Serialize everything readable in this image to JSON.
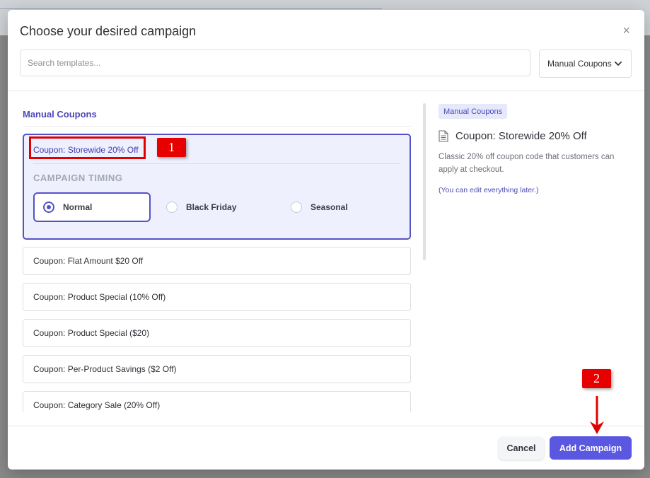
{
  "modal": {
    "title": "Choose your desired campaign",
    "close_icon": "×",
    "search": {
      "placeholder": "Search templates..."
    },
    "filter_select": {
      "value": "Manual Coupons"
    }
  },
  "list": {
    "section_title": "Manual Coupons",
    "selected_item": {
      "label": "Coupon: Storewide 20% Off",
      "timing_title": "CAMPAIGN TIMING",
      "timing_options": [
        {
          "label": "Normal",
          "selected": true
        },
        {
          "label": "Black Friday",
          "selected": false
        },
        {
          "label": "Seasonal",
          "selected": false
        }
      ]
    },
    "items": [
      "Coupon: Flat Amount $20 Off",
      "Coupon: Product Special (10% Off)",
      "Coupon: Product Special ($20)",
      "Coupon: Per-Product Savings ($2 Off)",
      "Coupon: Category Sale (20% Off)"
    ]
  },
  "preview": {
    "badge": "Manual Coupons",
    "title": "Coupon: Storewide 20% Off",
    "description": "Classic 20% off coupon code that customers can apply at checkout.",
    "note": "(You can edit everything later.)"
  },
  "footer": {
    "cancel_label": "Cancel",
    "add_label": "Add Campaign"
  },
  "annotations": {
    "step1": "1",
    "step2": "2"
  },
  "colors": {
    "accent": "#5552c7",
    "primary_button": "#5a57e0",
    "annotation_red": "#e60000"
  }
}
